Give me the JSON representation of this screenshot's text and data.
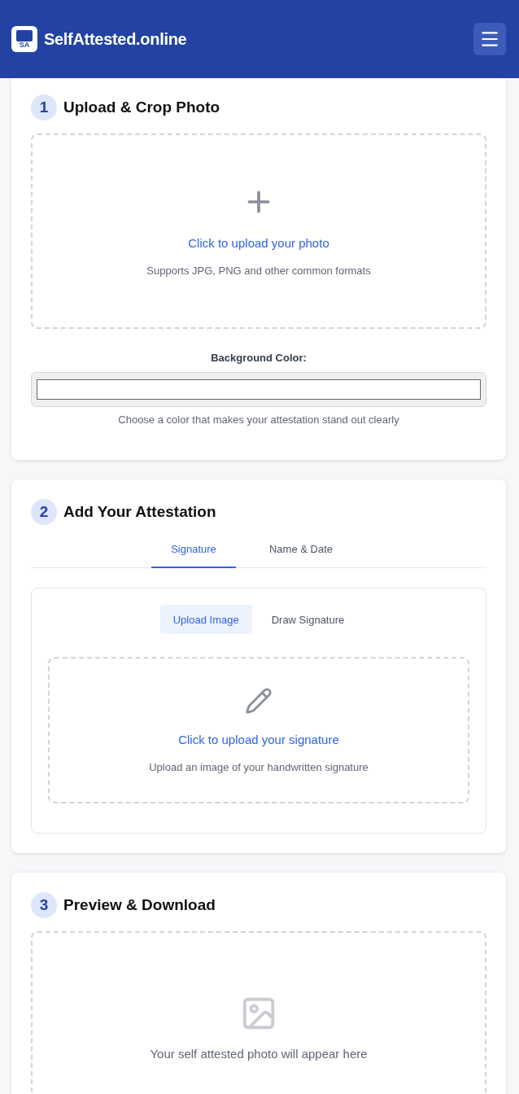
{
  "header": {
    "logo_text": "SA",
    "title": "SelfAttested.online"
  },
  "sections": [
    {
      "kind": "photo",
      "number": "1",
      "title": "Upload & Crop Photo",
      "upload": {
        "link": "Click to upload your photo",
        "hint": "Supports JPG, PNG and other common formats"
      },
      "background_color": {
        "label": "Background Color:",
        "color": "#ffffff",
        "hint": "Choose a color that makes your attestation stand out clearly"
      }
    },
    {
      "kind": "attestation",
      "number": "2",
      "title": "Add Your Attestation",
      "tabs": [
        {
          "label": "Signature",
          "selected": true
        },
        {
          "label": "Name & Date",
          "selected": false
        }
      ],
      "modes": [
        {
          "label": "Upload Image",
          "selected": true
        },
        {
          "label": "Draw Signature",
          "selected": false
        }
      ],
      "upload": {
        "link": "Click to upload your signature",
        "hint": "Upload an image of your handwritten signature"
      }
    },
    {
      "kind": "preview",
      "number": "3",
      "title": "Preview & Download",
      "message": "Your self attested photo will appear here"
    }
  ]
}
